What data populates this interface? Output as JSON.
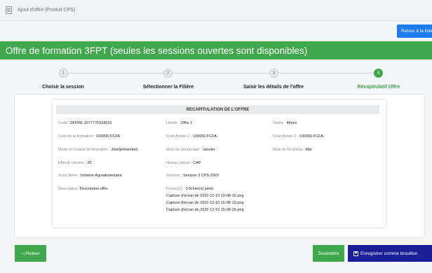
{
  "breadcrumb": {
    "text": "Ajout d'offre (Produit CPS)"
  },
  "actions": {
    "back_to_list": "Retour à la liste",
    "retour": "◁ Retour",
    "submit": "Soumettre",
    "save_draft": "Enregistrer comme brouillon"
  },
  "header": {
    "title": "Offre de formation 3FPT (seules les sessions ouvertes sont disponibles)"
  },
  "stepper": {
    "active_step": 4,
    "steps": [
      {
        "number": "1",
        "label": "Choisir la session"
      },
      {
        "number": "2",
        "label": "Sélectionner la Filière"
      },
      {
        "number": "3",
        "label": "Saisir les détails de l'offre"
      },
      {
        "number": "4",
        "label": "Récapitulatif Offre"
      }
    ]
  },
  "recap": {
    "title": "RECAPITULATION DE L'OFFRE",
    "code": {
      "label": "Code:",
      "value": "OFFRE-1677775333610"
    },
    "libelle": {
      "label": "Libellé :",
      "value": "Offre 1"
    },
    "duree": {
      "label": "Durée :",
      "value": "4mois"
    },
    "cout_formation": {
      "label": "Coût de la formation :",
      "value": "100000 FCFA"
    },
    "cout_annee2": {
      "label": "Coût Année 2 :",
      "value": "100000 FCFA"
    },
    "cout_annee3": {
      "label": "Coût Année 3 :",
      "value": "100000 FCFA"
    },
    "mode_horaire": {
      "label": "Mode et horaire de formation :",
      "value": "Jour(présentiel)"
    },
    "mois_demarrage": {
      "label": "Mois de demarrage :",
      "value": "Janvier"
    },
    "mois_fin": {
      "label": "Mois de fin prévu :",
      "value": "Mai"
    },
    "effectif": {
      "label": "Effectif cohorte :",
      "value": "20"
    },
    "niveau": {
      "label": "Niveau requis :",
      "value": "CAP"
    },
    "sous_filiere": {
      "label": "Sous filière :",
      "value": "Indistrie Agroalimentaire"
    },
    "session": {
      "label": "Session :",
      "value": "Session 3 CPS 2023"
    },
    "description": {
      "label": "Description:",
      "value": "Description offre"
    },
    "fichiers": {
      "label": "Fichier(s) :",
      "value": "3 fichier(s) joints",
      "files": [
        "Capture d'écran de 2022-12-10 15-08-16.png",
        "Capture d'écran de 2022-12-10 15-08-19.png",
        "Capture d'écran de 2022-12-10 15-08-26.png"
      ]
    }
  }
}
